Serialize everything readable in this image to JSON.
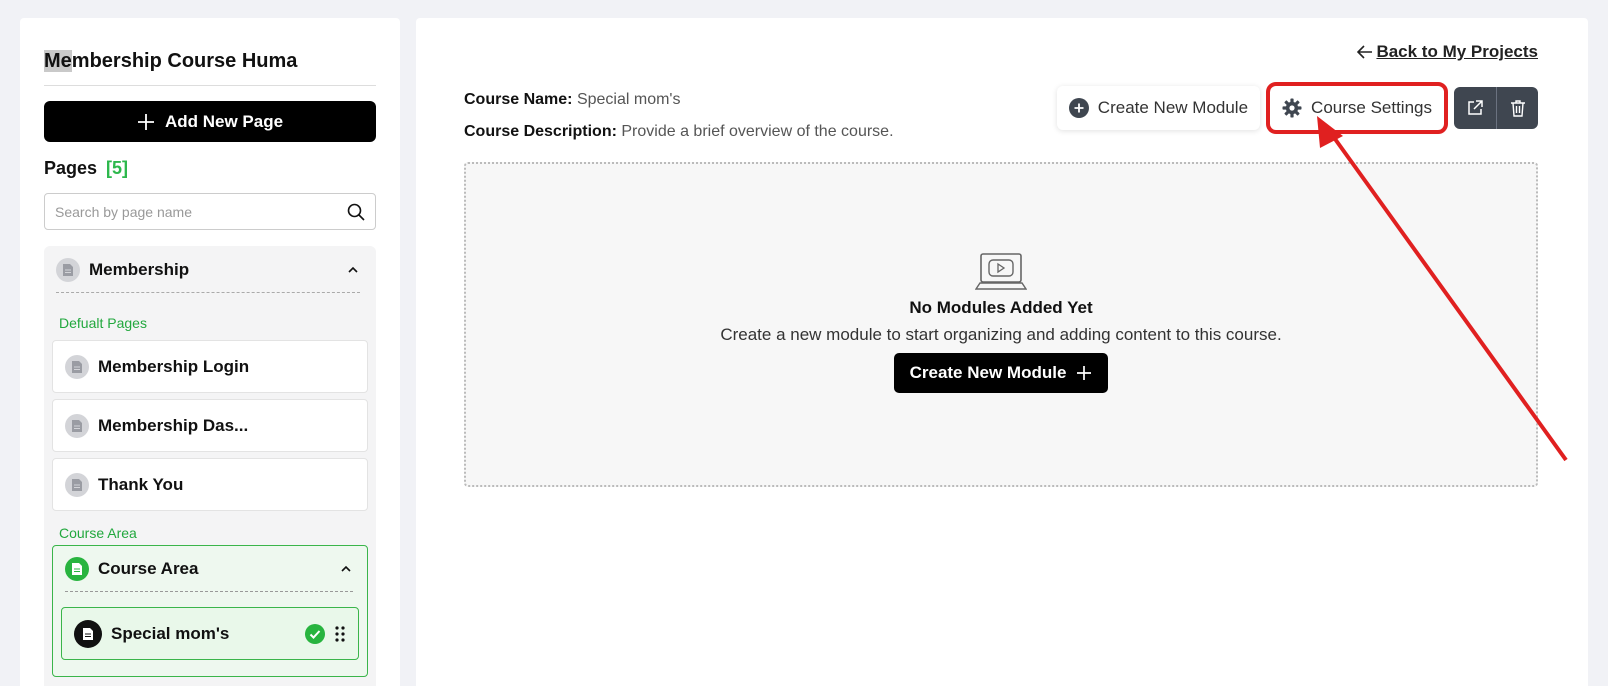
{
  "sidebar": {
    "project_title_highlight": "Me",
    "project_title_rest": "mbership Course Huma",
    "add_page_label": "Add New Page",
    "pages_label": "Pages",
    "pages_count": "[5]",
    "search_placeholder": "Search by page name",
    "group_name": "Membership",
    "default_pages_label": "Defualt Pages",
    "default_pages": [
      {
        "label": "Membership Login"
      },
      {
        "label": "Membership Das..."
      },
      {
        "label": "Thank You"
      }
    ],
    "course_area_label": "Course Area",
    "course_area_name": "Course Area",
    "course_item": "Special mom's"
  },
  "main": {
    "back_label": "Back to My Projects",
    "course_name_label": "Course Name:",
    "course_name_value": "Special mom's",
    "course_desc_label": "Course Description:",
    "course_desc_value": "Provide a brief overview of the course.",
    "create_module_label": "Create New Module",
    "course_settings_label": "Course Settings",
    "empty_title": "No Modules Added Yet",
    "empty_desc": "Create a new module to start organizing and adding content to this course.",
    "empty_create_label": "Create New Module"
  },
  "colors": {
    "accent_green": "#2db84c",
    "annotation_red": "#e02020",
    "dark_button": "#3f4650"
  }
}
